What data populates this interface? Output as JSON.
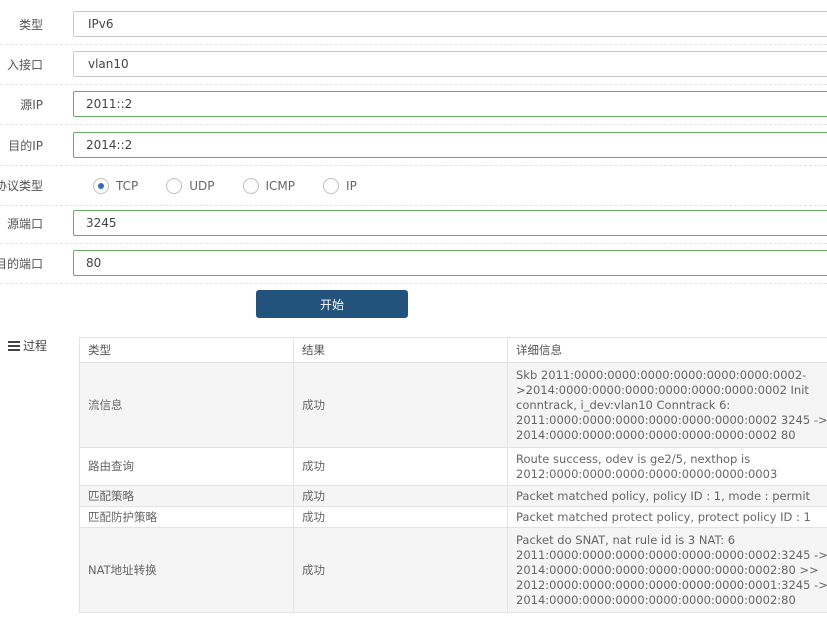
{
  "form": {
    "type": {
      "label": "类型",
      "value": "IPv6"
    },
    "in_if": {
      "label": "入接口",
      "value": "vlan10"
    },
    "src_ip": {
      "label": "源IP",
      "value": "2011::2"
    },
    "dst_ip": {
      "label": "目的IP",
      "value": "2014::2"
    },
    "protocol": {
      "label": "协议类型",
      "options": [
        "TCP",
        "UDP",
        "ICMP",
        "IP"
      ],
      "selected": "TCP"
    },
    "src_port": {
      "label": "源端口",
      "value": "3245"
    },
    "dst_port": {
      "label": "目的端口",
      "value": "80"
    },
    "start_label": "开始"
  },
  "process": {
    "title": "过程",
    "headers": [
      "类型",
      "结果",
      "详细信息"
    ],
    "rows": [
      {
        "type": "流信息",
        "result": "成功",
        "detail": [
          "Skb 2011:0000:0000:0000:0000:0000:0000:0002-",
          ">2014:0000:0000:0000:0000:0000:0000:0002 Init",
          "conntrack, i_dev:vlan10 Conntrack 6:",
          "2011:0000:0000:0000:0000:0000:0000:0002 3245 ->",
          "2014:0000:0000:0000:0000:0000:0000:0002 80"
        ]
      },
      {
        "type": "路由查询",
        "result": "成功",
        "detail": [
          "Route success, odev is ge2/5, nexthop is",
          "2012:0000:0000:0000:0000:0000:0000:0003"
        ]
      },
      {
        "type": "匹配策略",
        "result": "成功",
        "detail": [
          "Packet matched policy, policy ID : 1, mode : permit"
        ]
      },
      {
        "type": "匹配防护策略",
        "result": "成功",
        "detail": [
          "Packet matched protect policy, protect policy ID : 1"
        ]
      },
      {
        "type": "NAT地址转换",
        "result": "成功",
        "detail": [
          "Packet do SNAT, nat rule id is 3 NAT: 6",
          "2011:0000:0000:0000:0000:0000:0000:0002:3245 ->",
          "2014:0000:0000:0000:0000:0000:0000:0002:80 >>",
          "2012:0000:0000:0000:0000:0000:0000:0001:3245 ->",
          "2014:0000:0000:0000:0000:0000:0000:0002:80"
        ]
      }
    ]
  },
  "colors": {
    "button": "#23527c",
    "input_border_active": "#6aa86a",
    "radio_checked": "#2a6ebb"
  }
}
